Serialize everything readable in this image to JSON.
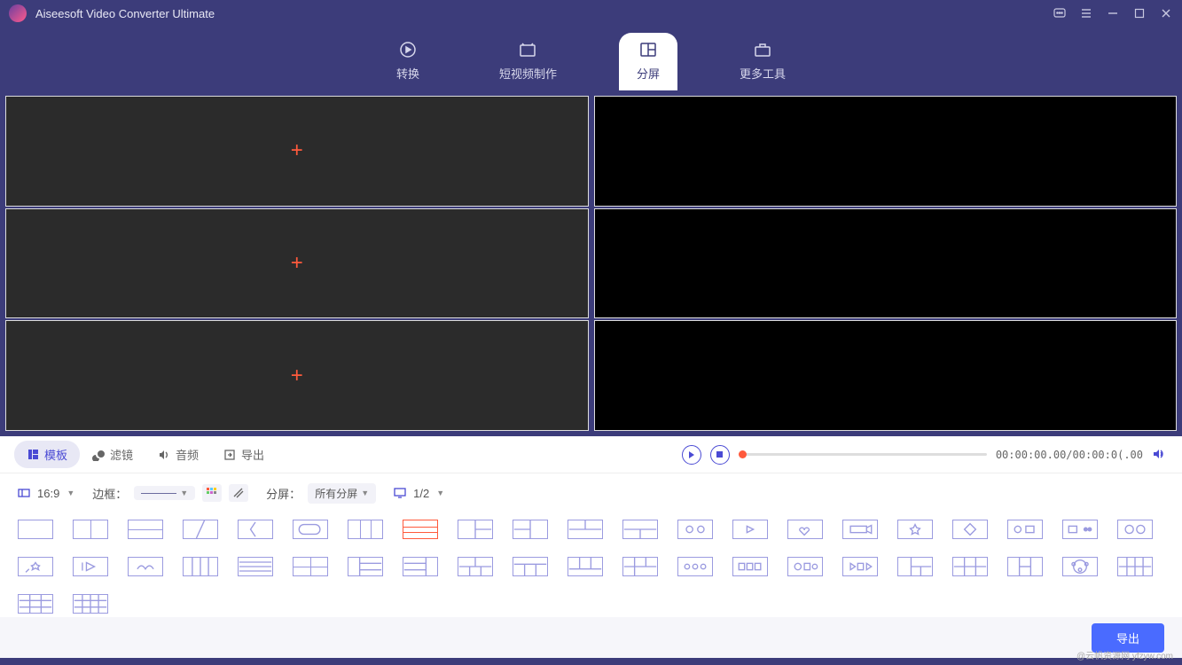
{
  "app": {
    "title": "Aiseesoft Video Converter Ultimate"
  },
  "nav": {
    "tabs": [
      {
        "label": "转换"
      },
      {
        "label": "短视频制作"
      },
      {
        "label": "分屏"
      },
      {
        "label": "更多工具"
      }
    ]
  },
  "panel": {
    "tabs": [
      {
        "label": "模板"
      },
      {
        "label": "滤镜"
      },
      {
        "label": "音频"
      },
      {
        "label": "导出"
      }
    ]
  },
  "playback": {
    "timecode": "00:00:00.00/00:00:0(.00"
  },
  "options": {
    "aspect_label": "16:9",
    "border_label": "边框：",
    "split_label": "分屏：",
    "split_value": "所有分屏",
    "page_value": "1/2"
  },
  "export": {
    "button": "导出"
  },
  "watermark": "@云帆资源网 yfzyw.com"
}
